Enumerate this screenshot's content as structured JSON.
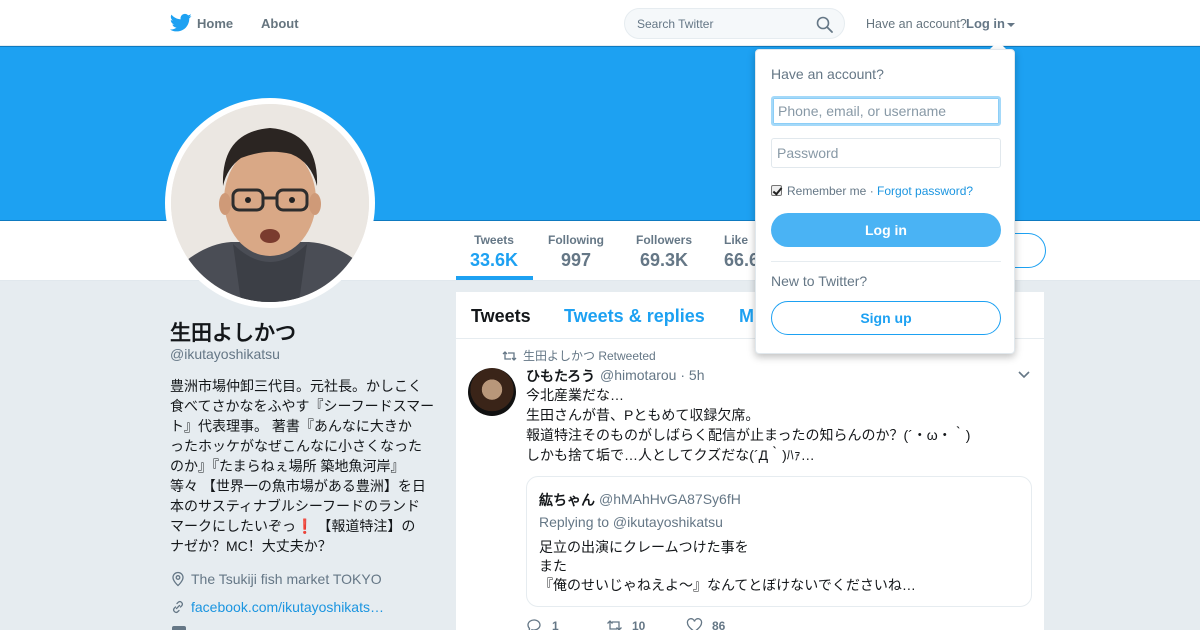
{
  "topbar": {
    "home_label": "Home",
    "about_label": "About",
    "search_placeholder": "Search Twitter",
    "have_account": "Have an account?",
    "login_label": "Log in"
  },
  "profile": {
    "name": "生田よしかつ",
    "handle": "@ikutayoshikatsu",
    "bio_lines": [
      "豊洲市場仲卸三代目。元社長。かしこく",
      "食べてさかなをふやす『シーフードスマー",
      "ト』代表理事。 著書『あんなに大きか",
      "ったホッケがなぜこんなに小さくなった",
      "のか』『たまらねぇ場所 築地魚河岸』",
      "等々 【世界一の魚市場がある豊洲】を日",
      "本のサスティナブルシーフードのランド",
      "マークにしたいぞっ",
      "【報道特注】の",
      "ナゼか？MC！大丈夫か？"
    ],
    "exclamation": "❗",
    "location": "The Tsukiji fish market TOKYO",
    "url": "facebook.com/ikutayoshikats…"
  },
  "stats": [
    {
      "label": "Tweets",
      "value": "33.6K"
    },
    {
      "label": "Following",
      "value": "997"
    },
    {
      "label": "Followers",
      "value": "69.3K"
    },
    {
      "label": "Like",
      "value": "66.6"
    }
  ],
  "tabs": [
    "Tweets",
    "Tweets & replies",
    "M"
  ],
  "tweet": {
    "retweeted_by": "生田よしかつ Retweeted",
    "author_name": "ひもたろう",
    "author_meta": "@himotarou · 5h",
    "text_lines": [
      "今北産業だな…",
      "生田さんが昔、Pともめて収録欠席。",
      "報道特注そのものがしばらく配信が止まったの知らんのか？(´・ω・｀)",
      "しかも捨て垢で…人としてクズだな(´Д｀)ﾊｧ…"
    ],
    "quote": {
      "name": "紘ちゃん",
      "handle": "@hMAhHvGA87Sy6fH",
      "replying_to": "Replying to @ikutayoshikatsu",
      "text_lines": [
        "足立の出演にクレームつけた事を",
        "また",
        "『俺のせいじゃねえよ～』なんてとぼけないでくださいね…"
      ]
    },
    "actions": {
      "replies": "1",
      "retweets": "10",
      "likes": "86"
    }
  },
  "login_dropdown": {
    "title": "Have an account?",
    "username_placeholder": "Phone, email, or username",
    "password_placeholder": "Password",
    "remember_label": "Remember me",
    "separator": " · ",
    "forgot_label": "Forgot password?",
    "login_button": "Log in",
    "new_label": "New to Twitter?",
    "signup_button": "Sign up"
  },
  "colors": {
    "brand": "#1da1f2",
    "login_button": "#4ab3f4",
    "link": "#1b95e0"
  }
}
